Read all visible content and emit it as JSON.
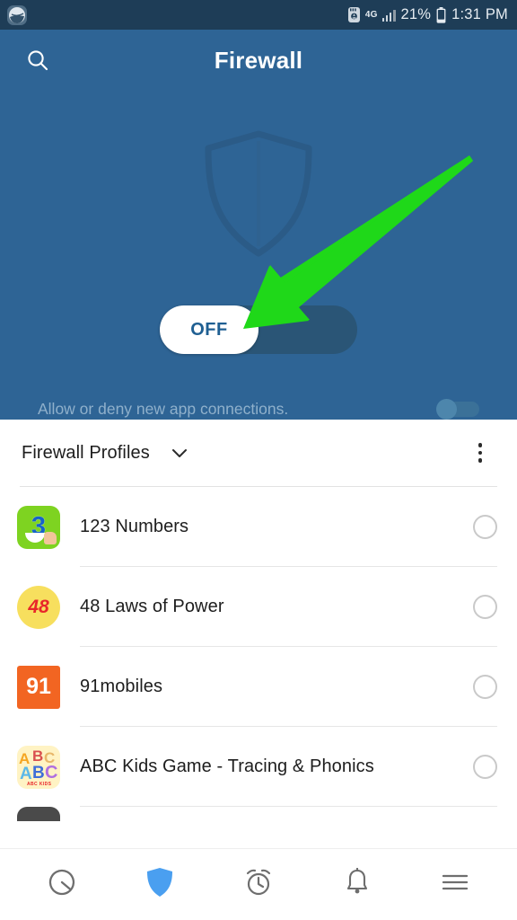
{
  "status_bar": {
    "notification_icon": "app-notification-icon",
    "sd_card_icon": "sd-card-icon",
    "network_type": "4G",
    "signal_icon": "signal-bars-icon",
    "battery_percent": "21%",
    "battery_icon": "battery-icon",
    "time": "1:31 PM",
    "background_color": "#1e3d57"
  },
  "header": {
    "title": "Firewall",
    "search_icon": "search-icon",
    "background_color": "#2e6495",
    "shield_icon": "shield-outline-icon"
  },
  "main_toggle": {
    "label": "OFF",
    "state": "off",
    "knob_color": "#ffffff",
    "track_color": "#2a5576",
    "label_color": "#1f5f92"
  },
  "sub_setting": {
    "text": "Allow or deny new app connections.",
    "toggle_state": "off",
    "text_color": "#8fb0cb"
  },
  "annotation": {
    "type": "arrow",
    "color": "#1fd819",
    "points_to": "main-toggle"
  },
  "profiles": {
    "title": "Firewall Profiles",
    "chevron_icon": "chevron-down-icon",
    "overflow_icon": "overflow-menu-icon"
  },
  "apps": [
    {
      "name": "123 Numbers",
      "icon_name": "app-icon-123-numbers",
      "icon_class": "ic-123",
      "icon_text": "3",
      "selected": false
    },
    {
      "name": "48 Laws of Power",
      "icon_name": "app-icon-48-laws-of-power",
      "icon_class": "ic-48",
      "icon_text": "48",
      "selected": false
    },
    {
      "name": "91mobiles",
      "icon_name": "app-icon-91mobiles",
      "icon_class": "ic-91",
      "icon_text": "91",
      "selected": false
    },
    {
      "name": "ABC Kids Game - Tracing & Phonics",
      "icon_name": "app-icon-abc-kids-game",
      "icon_class": "ic-abc",
      "icon_text": "",
      "selected": false
    }
  ],
  "bottom_nav": {
    "items": [
      {
        "icon_name": "dashboard-circle-icon",
        "active": false
      },
      {
        "icon_name": "shield-icon",
        "active": true
      },
      {
        "icon_name": "alarm-clock-icon",
        "active": false
      },
      {
        "icon_name": "bell-notification-icon",
        "active": false
      },
      {
        "icon_name": "hamburger-menu-icon",
        "active": false
      }
    ],
    "active_color": "#4a9ff0",
    "inactive_color": "#6e6e6e"
  }
}
